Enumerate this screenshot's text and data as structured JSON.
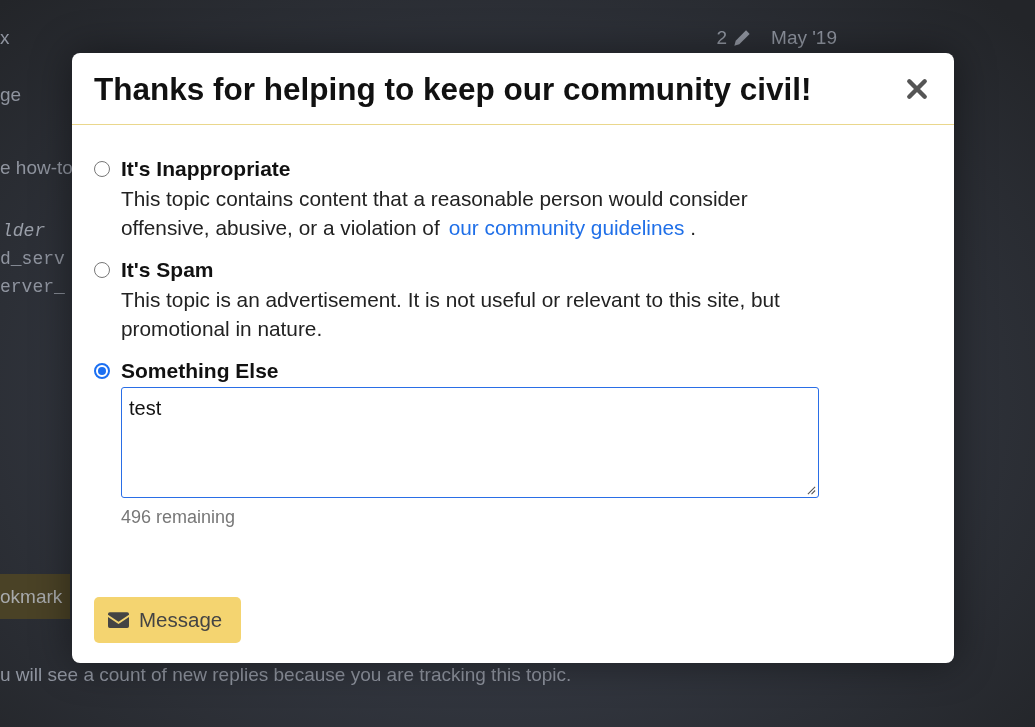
{
  "background_page": {
    "lines": [
      "x",
      "ge",
      "e how-to"
    ],
    "post_meta": {
      "edits": "2",
      "date": "May '19"
    },
    "code_lines": [
      {
        "text": "lder",
        "kind": "italic"
      },
      {
        "text": "d_serv",
        "kind": "plain"
      },
      {
        "text": "erver_",
        "kind": "plain"
      }
    ],
    "bookmark_button": "okmark",
    "tracking_notice": "u will see a count of new replies because you are tracking this topic."
  },
  "modal": {
    "title": "Thanks for helping to keep our community civil!",
    "options": [
      {
        "label": "It's Inappropriate",
        "selected": false,
        "description": "This topic contains content that a reasonable person would consider offensive, abusive, or a violation of",
        "link": "our community guidelines",
        "description_end": "."
      },
      {
        "label": "It's Spam",
        "selected": false,
        "description": "This topic is an advertisement. It is not useful or relevant to this site, but promotional in nature."
      },
      {
        "label": "Something Else",
        "selected": true,
        "message": {
          "value": "test",
          "counter": "496 remaining"
        }
      }
    ],
    "submit_button": "Message"
  }
}
